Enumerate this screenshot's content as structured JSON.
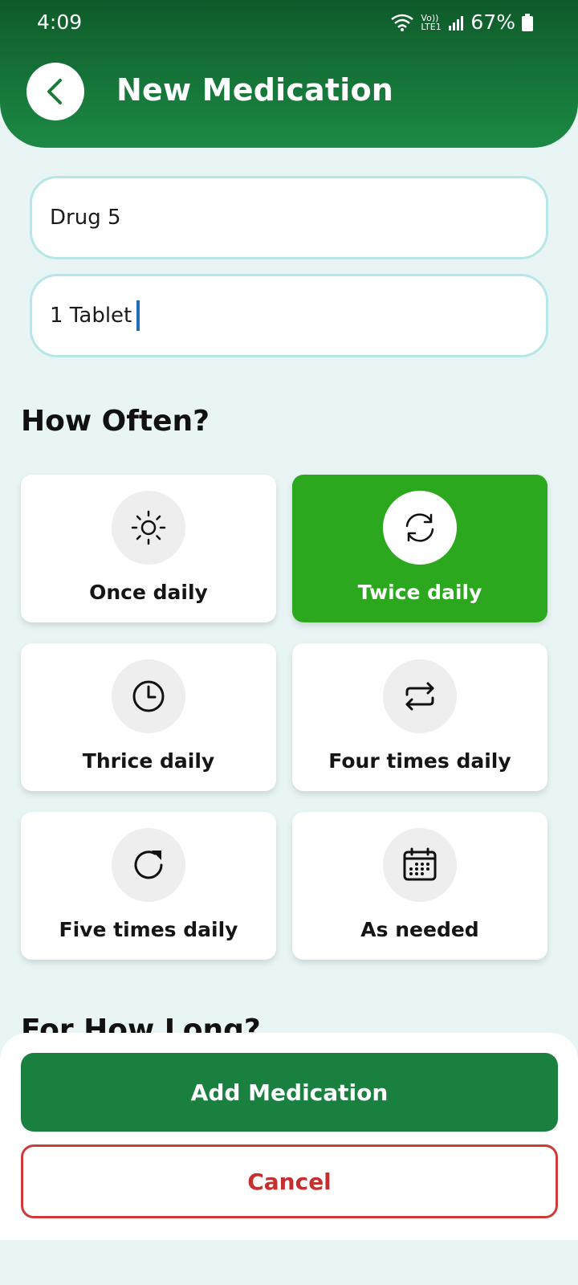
{
  "status_bar": {
    "time": "4:09",
    "network": "Vo)) LTE1",
    "battery": "67%"
  },
  "header": {
    "title": "New Medication"
  },
  "form": {
    "drug_name": "Drug 5",
    "dosage": "1 Tablet"
  },
  "how_often": {
    "title": "How Often?",
    "options": [
      {
        "label": "Once daily",
        "icon": "sun-icon",
        "selected": false
      },
      {
        "label": "Twice daily",
        "icon": "refresh-icon",
        "selected": true
      },
      {
        "label": "Thrice daily",
        "icon": "clock-icon",
        "selected": false
      },
      {
        "label": "Four times daily",
        "icon": "repeat-icon",
        "selected": false
      },
      {
        "label": "Five times daily",
        "icon": "rotate-right-icon",
        "selected": false
      },
      {
        "label": "As needed",
        "icon": "calendar-icon",
        "selected": false
      }
    ]
  },
  "for_how_long": {
    "title": "For How Long?"
  },
  "actions": {
    "add_label": "Add Medication",
    "cancel_label": "Cancel"
  },
  "colors": {
    "header": "#1b8a44",
    "selected_card": "#2ca81e",
    "add_button": "#1a8040",
    "cancel_border": "#cc3a3a",
    "background": "#e8f5f4"
  }
}
